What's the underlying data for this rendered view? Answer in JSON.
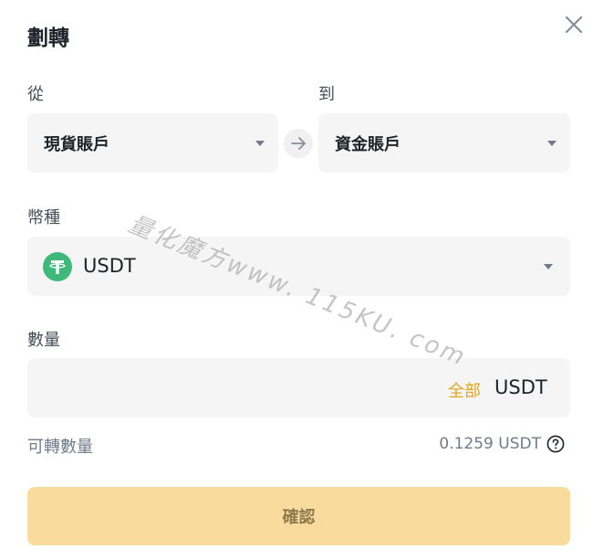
{
  "dialog": {
    "title": "劃轉"
  },
  "from": {
    "label": "從",
    "account": "現貨賬戶"
  },
  "to": {
    "label": "到",
    "account": "資金賬戶"
  },
  "coin": {
    "label": "幣種",
    "symbol": "USDT",
    "icon_color": "#3fb97a"
  },
  "amount": {
    "label": "數量",
    "all_label": "全部",
    "unit": "USDT",
    "value": ""
  },
  "available": {
    "label": "可轉數量",
    "value": "0.1259 USDT"
  },
  "confirm_label": "確認",
  "watermark": "量化魔方www. 115KU. com",
  "colors": {
    "accent": "#e1a620",
    "button_bg": "#f9dc9d",
    "field_bg": "#f5f5f5"
  }
}
